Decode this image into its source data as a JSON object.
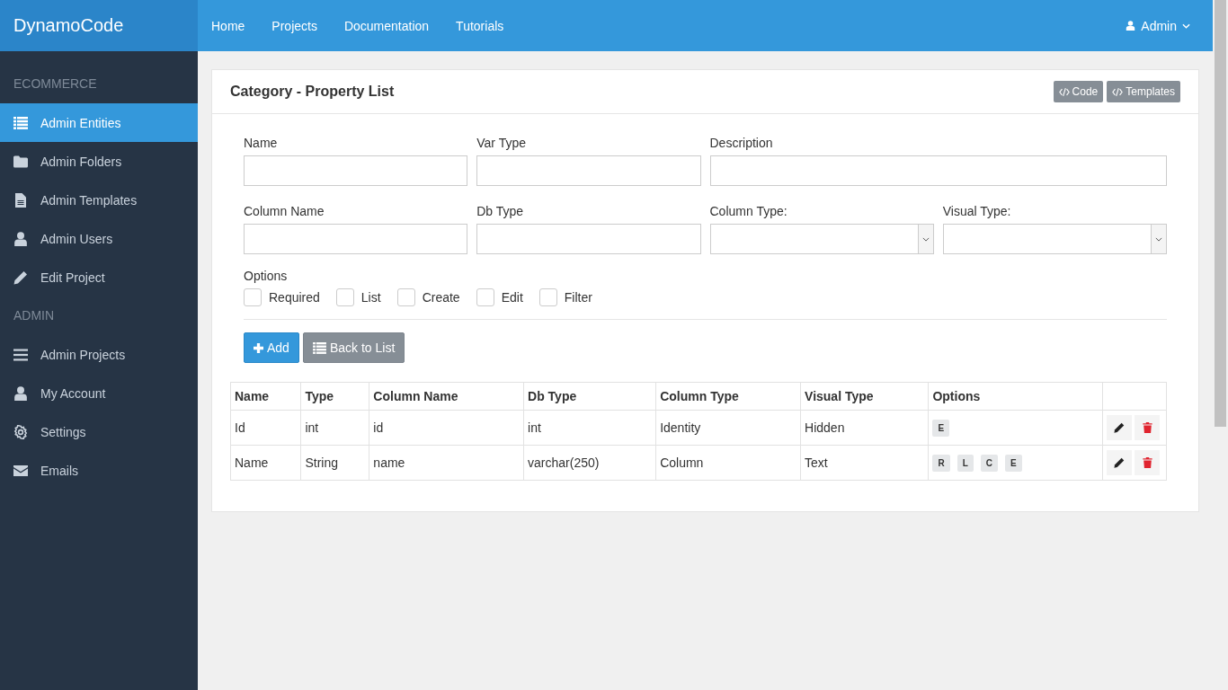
{
  "brand": "DynamoCode",
  "nav": [
    {
      "label": "Home"
    },
    {
      "label": "Projects"
    },
    {
      "label": "Documentation"
    },
    {
      "label": "Tutorials"
    }
  ],
  "user_menu": {
    "label": "Admin"
  },
  "sidebar": {
    "sections": [
      {
        "header": "ECOMMERCE",
        "items": [
          {
            "label": "Admin Entities",
            "selected": true
          },
          {
            "label": "Admin Folders",
            "selected": false
          },
          {
            "label": "Admin Templates",
            "selected": false
          },
          {
            "label": "Admin Users",
            "selected": false
          },
          {
            "label": "Edit Project",
            "selected": false
          }
        ]
      },
      {
        "header": "ADMIN",
        "items": [
          {
            "label": "Admin Projects",
            "selected": false
          },
          {
            "label": "My Account",
            "selected": false
          },
          {
            "label": "Settings",
            "selected": false
          },
          {
            "label": "Emails",
            "selected": false
          }
        ]
      }
    ]
  },
  "card": {
    "title": "Category - Property List",
    "header_buttons": [
      {
        "label": "Code"
      },
      {
        "label": "Templates"
      }
    ]
  },
  "form": {
    "fields": [
      {
        "label": "Name",
        "kind": "text"
      },
      {
        "label": "Var Type",
        "kind": "text"
      },
      {
        "label": "Description",
        "kind": "widetext"
      },
      {
        "label": "Column Name",
        "kind": "text"
      },
      {
        "label": "Db Type",
        "kind": "text"
      },
      {
        "label": "Column Type:",
        "kind": "select"
      },
      {
        "label": "Visual Type:",
        "kind": "select"
      }
    ],
    "options_label": "Options",
    "options": [
      {
        "label": "Required",
        "checked": false
      },
      {
        "label": "List",
        "checked": false
      },
      {
        "label": "Create",
        "checked": false
      },
      {
        "label": "Edit",
        "checked": false
      },
      {
        "label": "Filter",
        "checked": false
      }
    ],
    "buttons": [
      {
        "label": "Add",
        "kind": "primary"
      },
      {
        "label": "Back to List",
        "kind": "secondary"
      }
    ]
  },
  "table": {
    "columns": [
      "Name",
      "Type",
      "Column Name",
      "Db Type",
      "Column Type",
      "Visual Type",
      "Options"
    ],
    "rows": [
      {
        "cells": [
          "Id",
          "int",
          "id",
          "int",
          "Identity",
          "Hidden"
        ],
        "options": [
          "E"
        ]
      },
      {
        "cells": [
          "Name",
          "String",
          "name",
          "varchar(250)",
          "Column",
          "Text"
        ],
        "options": [
          "R",
          "L",
          "C",
          "E"
        ]
      }
    ]
  }
}
